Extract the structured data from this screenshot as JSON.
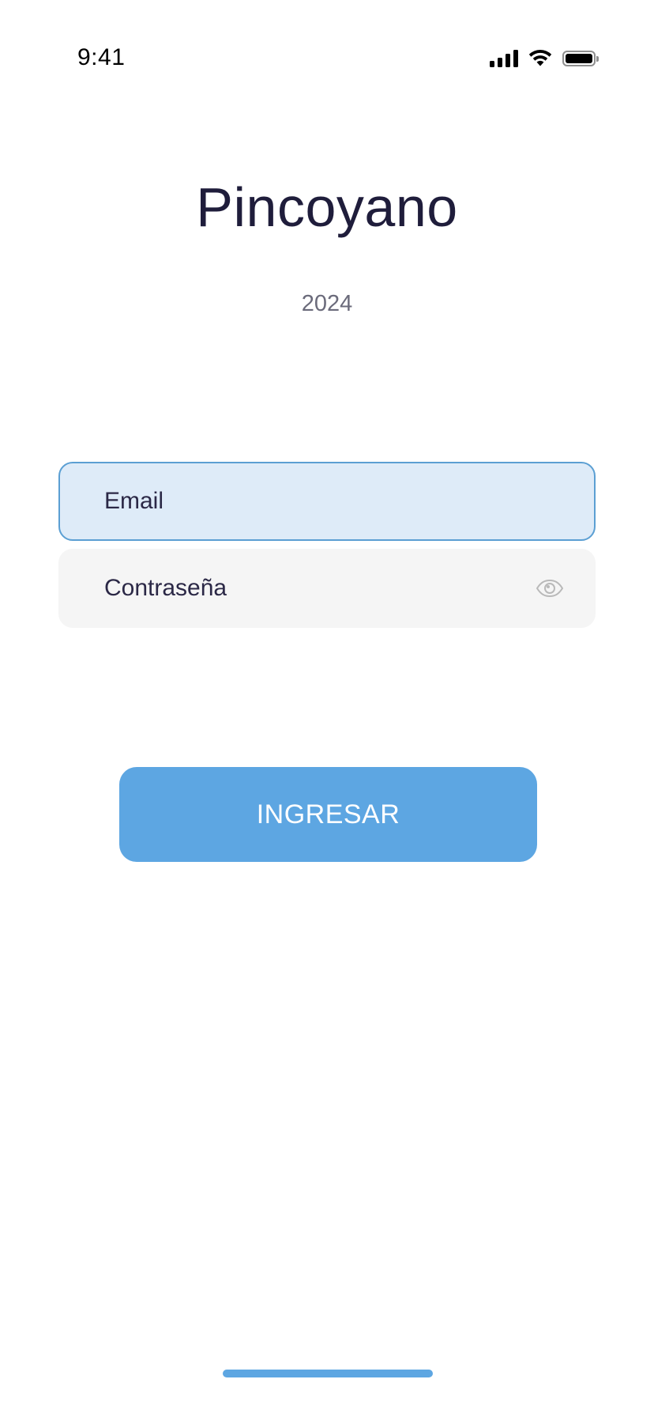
{
  "status_bar": {
    "time": "9:41",
    "icons": [
      "cellular-signal-icon",
      "wifi-icon",
      "battery-icon"
    ]
  },
  "header": {
    "title": "Pincoyano",
    "year": "2024"
  },
  "form": {
    "email_placeholder": "Email",
    "password_placeholder": "Contraseña",
    "password_toggle_icon": "eye-icon",
    "submit_label": "INGRESAR"
  },
  "colors": {
    "title": "#1f1d3b",
    "accent": "#5da6e2",
    "email_field_bg": "#deebf8",
    "email_field_border": "#5b9fd3",
    "password_field_bg": "#f5f5f5"
  }
}
